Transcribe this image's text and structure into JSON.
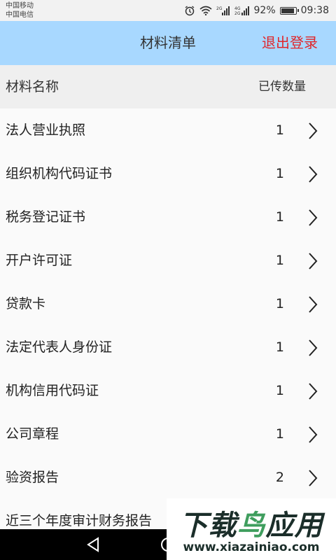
{
  "status_bar": {
    "carrier_1": "中国移动",
    "carrier_2": "中国电信",
    "battery": "92%",
    "time": "09:38",
    "battery_level": 0.92,
    "icons": [
      "alarm-icon",
      "wifi-icon",
      "signal-2g-icon",
      "signal-4g-icon",
      "battery-icon"
    ]
  },
  "header": {
    "title": "材料清单",
    "logout_label": "退出登录",
    "background_color": "#a8d8ff",
    "logout_color": "#e0262a"
  },
  "columns": {
    "name": "材料名称",
    "count": "已传数量"
  },
  "items": [
    {
      "label": "法人营业执照",
      "count": "1"
    },
    {
      "label": "组织机构代码证书",
      "count": "1"
    },
    {
      "label": "税务登记证书",
      "count": "1"
    },
    {
      "label": "开户许可证",
      "count": "1"
    },
    {
      "label": "贷款卡",
      "count": "1"
    },
    {
      "label": "法定代表人身份证",
      "count": "1"
    },
    {
      "label": "机构信用代码证",
      "count": "1"
    },
    {
      "label": "公司章程",
      "count": "1"
    },
    {
      "label": "验资报告",
      "count": "2"
    },
    {
      "label": "近三个年度审计财务报告",
      "count": ""
    }
  ],
  "navigation": {
    "icons": [
      "back-icon",
      "home-icon"
    ]
  },
  "watermark": {
    "title": "下载鸟应用",
    "url": "www.xiazainiao.com"
  }
}
